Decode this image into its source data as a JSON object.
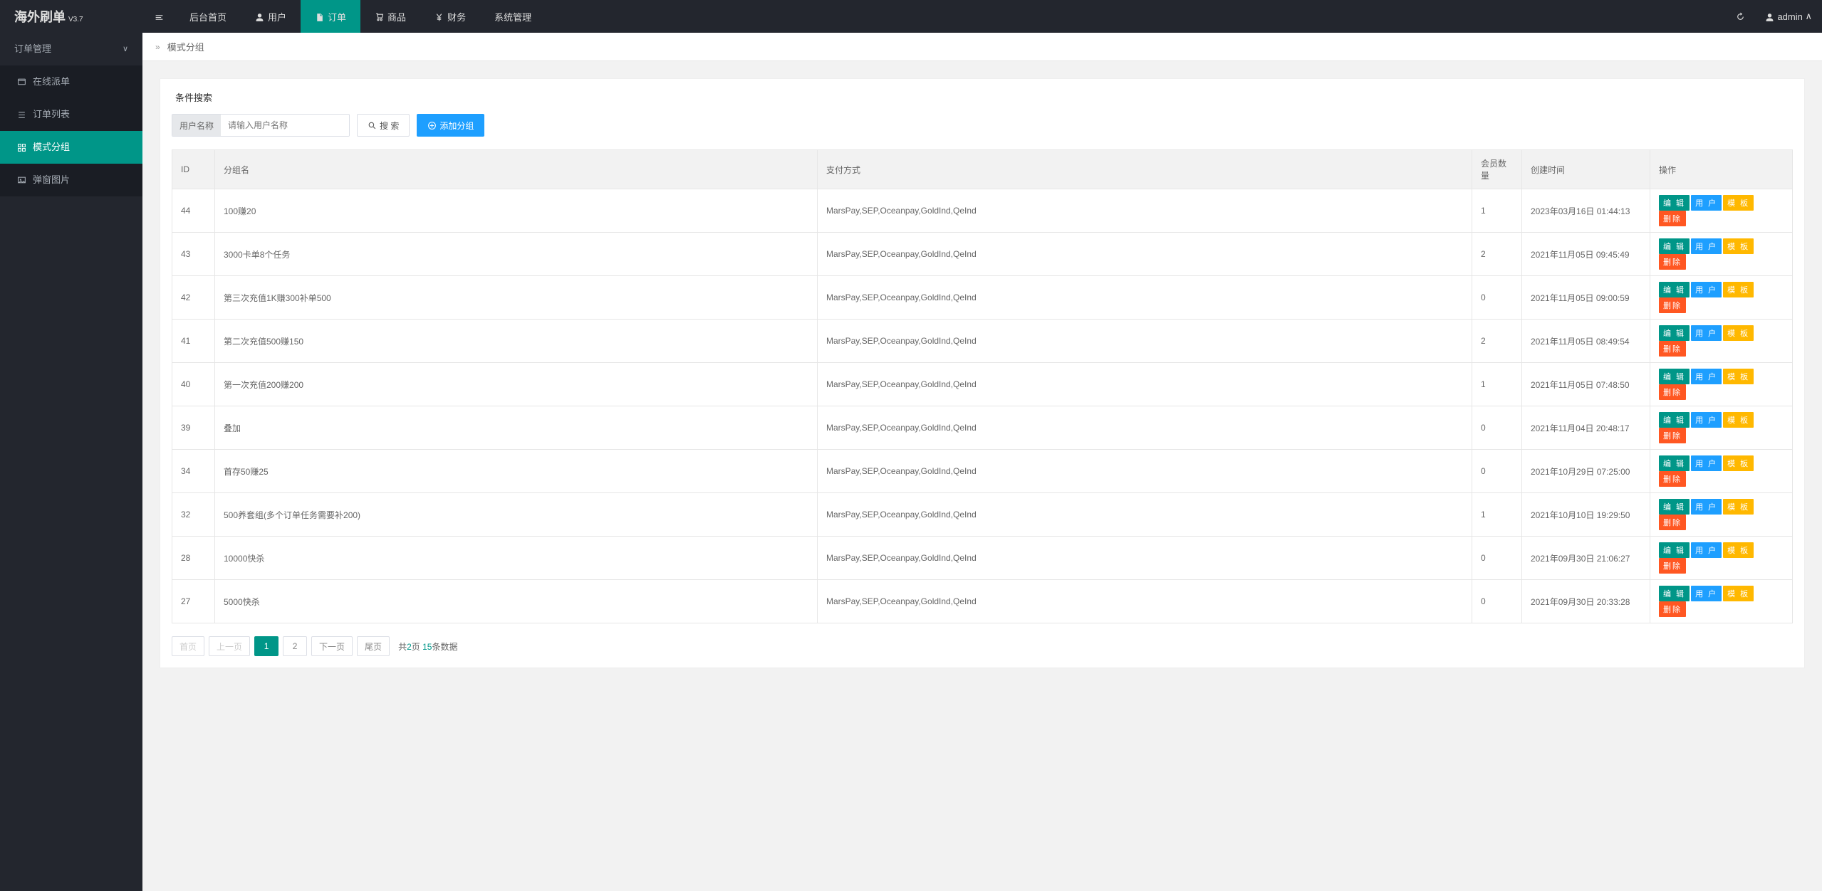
{
  "brand": {
    "name": "海外刷单",
    "version": "V3.7"
  },
  "topnav": {
    "items": [
      {
        "label": "后台首页",
        "icon": ""
      },
      {
        "label": "用户",
        "icon": "user"
      },
      {
        "label": "订单",
        "icon": "file",
        "active": true
      },
      {
        "label": "商品",
        "icon": "cart"
      },
      {
        "label": "财务",
        "icon": "yen"
      },
      {
        "label": "系统管理",
        "icon": ""
      }
    ]
  },
  "user": {
    "name": "admin",
    "chevron": "∧"
  },
  "sidebar": {
    "group": {
      "label": "订单管理",
      "chevron": "∨"
    },
    "items": [
      {
        "label": "在线派单",
        "icon": "dispatch"
      },
      {
        "label": "订单列表",
        "icon": "list"
      },
      {
        "label": "模式分组",
        "icon": "group",
        "active": true
      },
      {
        "label": "弹窗图片",
        "icon": "image"
      }
    ]
  },
  "breadcrumb": {
    "label": "模式分组"
  },
  "search": {
    "title": "条件搜索",
    "field_label": "用户名称",
    "placeholder": "请输入用户名称",
    "search_btn": "搜 索",
    "add_btn": "添加分组"
  },
  "table": {
    "headers": [
      "ID",
      "分组名",
      "支付方式",
      "会员数量",
      "创建时间",
      "操作"
    ],
    "actions": {
      "edit": "编 辑",
      "user": "用 户",
      "mod": "模 板",
      "del": "删除"
    },
    "rows": [
      {
        "id": "44",
        "name": "100赚20",
        "pay": "MarsPay,SEP,Oceanpay,GoldInd,QeInd",
        "count": "1",
        "time": "2023年03月16日 01:44:13"
      },
      {
        "id": "43",
        "name": "3000卡单8个任务",
        "pay": "MarsPay,SEP,Oceanpay,GoldInd,QeInd",
        "count": "2",
        "time": "2021年11月05日 09:45:49"
      },
      {
        "id": "42",
        "name": "第三次充值1K赚300补单500",
        "pay": "MarsPay,SEP,Oceanpay,GoldInd,QeInd",
        "count": "0",
        "time": "2021年11月05日 09:00:59"
      },
      {
        "id": "41",
        "name": "第二次充值500赚150",
        "pay": "MarsPay,SEP,Oceanpay,GoldInd,QeInd",
        "count": "2",
        "time": "2021年11月05日 08:49:54"
      },
      {
        "id": "40",
        "name": "第一次充值200赚200",
        "pay": "MarsPay,SEP,Oceanpay,GoldInd,QeInd",
        "count": "1",
        "time": "2021年11月05日 07:48:50"
      },
      {
        "id": "39",
        "name": "叠加",
        "pay": "MarsPay,SEP,Oceanpay,GoldInd,QeInd",
        "count": "0",
        "time": "2021年11月04日 20:48:17"
      },
      {
        "id": "34",
        "name": "首存50赚25",
        "pay": "MarsPay,SEP,Oceanpay,GoldInd,QeInd",
        "count": "0",
        "time": "2021年10月29日 07:25:00"
      },
      {
        "id": "32",
        "name": "500养套组(多个订单任务需要补200)",
        "pay": "MarsPay,SEP,Oceanpay,GoldInd,QeInd",
        "count": "1",
        "time": "2021年10月10日 19:29:50"
      },
      {
        "id": "28",
        "name": "10000快杀",
        "pay": "MarsPay,SEP,Oceanpay,GoldInd,QeInd",
        "count": "0",
        "time": "2021年09月30日 21:06:27"
      },
      {
        "id": "27",
        "name": "5000快杀",
        "pay": "MarsPay,SEP,Oceanpay,GoldInd,QeInd",
        "count": "0",
        "time": "2021年09月30日 20:33:28"
      }
    ]
  },
  "pagination": {
    "first": "首页",
    "prev": "上一页",
    "pages": [
      "1",
      "2"
    ],
    "current": "1",
    "next": "下一页",
    "last": "尾页",
    "info_prefix": "共",
    "total_pages": "2",
    "info_mid": "页 ",
    "total_records": "15",
    "info_suffix": "条数据"
  }
}
